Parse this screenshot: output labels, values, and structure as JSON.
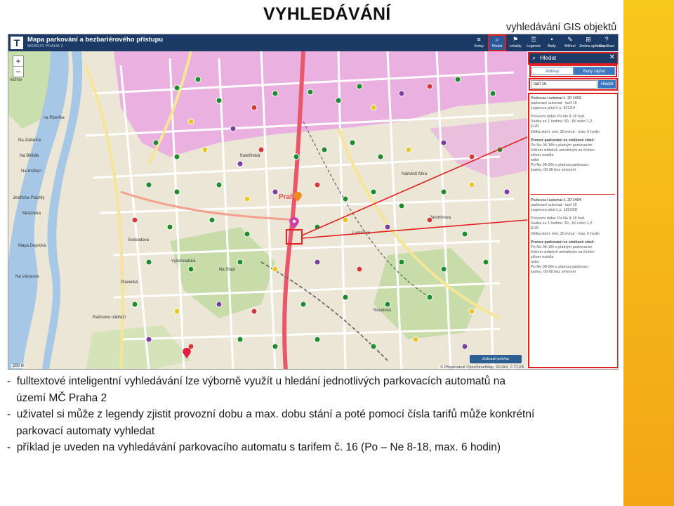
{
  "slide": {
    "title": "VYHLEDÁVÁNÍ",
    "caption": "vyhledávání GIS objektů"
  },
  "app": {
    "logo": "T",
    "title": "Mapa parkování a bezbariérového přístupu",
    "subtitle": "WEBGIS PRAHA 2",
    "toolbar": [
      {
        "label": "Vrstvy",
        "icon": "layers-icon",
        "glyph": "≡",
        "active": false
      },
      {
        "label": "Hledat",
        "icon": "search-icon",
        "glyph": "⌕",
        "active": true
      },
      {
        "label": "Lokality",
        "icon": "location-flag-icon",
        "glyph": "⚑",
        "active": false
      },
      {
        "label": "Legenda",
        "icon": "legend-icon",
        "glyph": "☰",
        "active": false
      },
      {
        "label": "Body",
        "icon": "points-icon",
        "glyph": "•",
        "active": false
      },
      {
        "label": "Měření",
        "icon": "ruler-icon",
        "glyph": "✎",
        "active": false
      },
      {
        "label": "Změna aplikace",
        "icon": "switch-app-icon",
        "glyph": "⊞",
        "active": false
      },
      {
        "label": "O aplikaci",
        "icon": "help-icon",
        "glyph": "?",
        "active": false
      }
    ]
  },
  "map": {
    "district_label": "Praha",
    "scale_label": "200 m",
    "attribution": "© Přispěvatelé OpenStreetMap, RUIAN, © ČÚZK",
    "locate_button": "Zobrazit polohu",
    "street_labels": [
      "nichov",
      "na Plzeňka",
      "Na Zatlance",
      "Na Bělidle",
      "Na Knížecí",
      "Jindřicha Plachty",
      "Mrázovka",
      "Mapa Dejvická",
      "Na Václavce",
      "Svobodova",
      "Vyšehradská",
      "Plavecká",
      "Na Slupi",
      "Lumírova",
      "Nuselská",
      "Kateřinská",
      "Náměstí Míru",
      "Rašínovo nábřeží",
      "Jaromírova"
    ]
  },
  "panel": {
    "header": "Hledat",
    "tabs": [
      {
        "label": "Adresy",
        "active": false
      },
      {
        "label": "Body zájmu",
        "active": true
      }
    ],
    "search_value": "tarif 16",
    "search_button": "Hledat",
    "results": [
      {
        "title": "Parkovací automat č. 20 1403",
        "lines": [
          "parkovací automat - tarif 16",
          "Legerova před č.p. 921/14"
        ],
        "hours": [
          "Provozní doba: Po-Ne 8-18 hod.",
          "Sazba za 1 hodinu: 30,- Kč nebo 1,2",
          "EUR",
          "Délka stání: min. 30 minut - max. 6 hodin"
        ],
        "zone_heading": "Provoz parkování ve smíšené zóně:",
        "zone_lines": [
          "Po-Ne 08-18h s platným parkovacím",
          "lístkem viditelně umístěným za čelním",
          "sklem vozidla",
          "nebo",
          "Po-Ne 08-06h s platnou parkovací",
          "kartou, 06-08 bez omezení"
        ]
      },
      {
        "title": "Parkovací automat č. 20 1404",
        "lines": [
          "parkovací automat - tarif 16",
          "Legerova před č.p. 1821/28"
        ],
        "hours": [
          "Provozní doba: Po-Ne 8-18 hod.",
          "Sazba za 1 hodinu: 30,- Kč nebo 1,2",
          "EUR",
          "Délka stání: min. 30 minut - max. 6 hodin"
        ],
        "zone_heading": "Provoz parkování ve smíšené zóně:",
        "zone_lines": [
          "Po-Ne 08-18h s platným parkovacím",
          "lístkem viditelně umístěným za čelním",
          "sklem vozidla",
          "nebo",
          "Po-Ne 08-06h s platnou parkovací",
          "kartou, 06-08 bez omezení"
        ]
      }
    ]
  },
  "bullets": [
    "-  fulltextové inteligentní vyhledávání lze výborně využít u hledání jednotlivých parkovacích automatů na",
    "   území MČ Praha 2",
    "-  uživatel si může z legendy zjistit provozní dobu a max. dobu stání a poté pomocí čísla tarifů může konkrétní",
    "   parkovací automaty vyhledat",
    "-  příklad je uveden na vyhledávání parkovacího automatu s tarifem č. 16 (Po – Ne 8-18, max. 6 hodin)"
  ],
  "colors": {
    "accent_red": "#e02020",
    "topbar": "#1c3a66",
    "stripe_top": "#f7c81c",
    "stripe_bottom": "#f3a516",
    "zone_pink": "#e98ce0",
    "main_road": "#e9586a"
  }
}
